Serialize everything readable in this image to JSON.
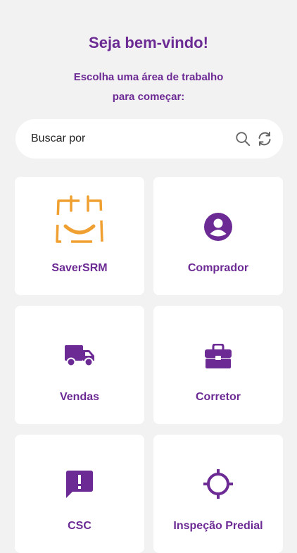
{
  "header": {
    "title": "Seja bem-vindo!",
    "subtitle_line1": "Escolha uma área de trabalho",
    "subtitle_line2": "para começar:"
  },
  "search": {
    "placeholder": "Buscar por",
    "search_icon": "search-icon",
    "refresh_icon": "refresh-icon"
  },
  "colors": {
    "accent": "#6c2a94",
    "logo_orange": "#f0a030",
    "background": "#f2f2f2",
    "card": "#ffffff"
  },
  "workspaces": [
    {
      "label": "SaverSRM",
      "icon": "shopping-bag-smile-logo"
    },
    {
      "label": "Comprador",
      "icon": "account-circle-icon"
    },
    {
      "label": "Vendas",
      "icon": "truck-icon"
    },
    {
      "label": "Corretor",
      "icon": "briefcase-icon"
    },
    {
      "label": "CSC",
      "icon": "alert-message-icon"
    },
    {
      "label": "Inspeção Predial",
      "icon": "crosshair-icon"
    }
  ]
}
